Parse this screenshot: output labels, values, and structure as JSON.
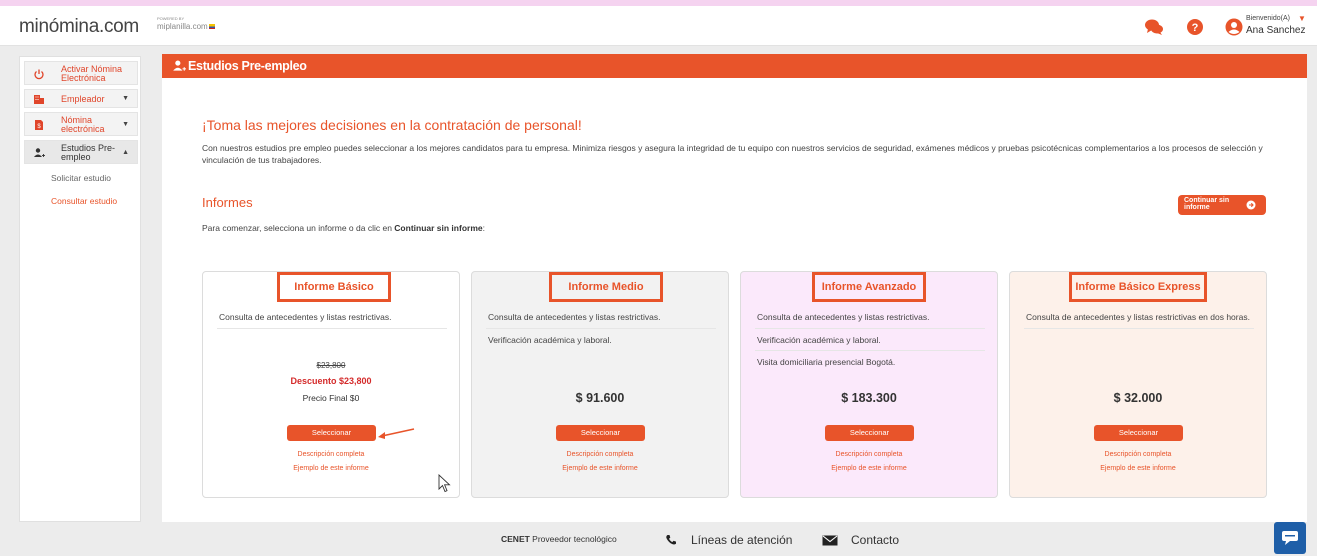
{
  "header": {
    "logo": "minómina.com",
    "powered_by": "POWERED BY",
    "partner": "miplanilla.com",
    "welcome": "Bienvenido(A)",
    "user_name": "Ana Sanchez"
  },
  "sidebar": {
    "items": [
      {
        "label": "Activar Nómina Electrónica"
      },
      {
        "label": "Empleador"
      },
      {
        "label": "Nómina electrónica"
      },
      {
        "label": "Estudios Pre-empleo"
      }
    ],
    "sub_items": [
      {
        "label": "Solicitar estudio"
      },
      {
        "label": "Consultar estudio"
      }
    ]
  },
  "main": {
    "title": "Estudios Pre-empleo",
    "headline": "¡Toma las mejores decisiones en la contratación de personal!",
    "description": "Con nuestros estudios pre empleo puedes seleccionar a los mejores candidatos para tu empresa. Minimiza riesgos y asegura la integridad de tu equipo con nuestros servicios de seguridad, exámenes médicos y pruebas psicotécnicas complementarios a los procesos de selección y vinculación de tus trabajadores.",
    "reports_heading": "Informes",
    "hint_prefix": "Para comenzar, selecciona un informe o da clic en ",
    "hint_bold": "Continuar sin informe",
    "hint_suffix": ":",
    "continue_button": "Continuar sin informe"
  },
  "cards": [
    {
      "title": "Informe Básico",
      "features": [
        "Consulta de antecedentes y listas restrictivas."
      ],
      "old_price": "$23,800",
      "discount": "Descuento $23,800",
      "final_price": "Precio Final $0",
      "select": "Seleccionar",
      "link1": "Descripción completa",
      "link2": "Ejemplo de este informe"
    },
    {
      "title": "Informe Medio",
      "features": [
        "Consulta de antecedentes y listas restrictivas.",
        "Verificación académica y laboral."
      ],
      "price": "$ 91.600",
      "select": "Seleccionar",
      "link1": "Descripción completa",
      "link2": "Ejemplo de este informe"
    },
    {
      "title": "Informe Avanzado",
      "features": [
        "Consulta de antecedentes y listas restrictivas.",
        "Verificación académica y laboral.",
        "Visita domiciliaria presencial Bogotá."
      ],
      "price": "$ 183.300",
      "select": "Seleccionar",
      "link1": "Descripción completa",
      "link2": "Ejemplo de este informe"
    },
    {
      "title": "Informe Básico Express",
      "features": [
        "Consulta de antecedentes y listas restrictivas en dos horas."
      ],
      "price": "$ 32.000",
      "select": "Seleccionar",
      "link1": "Descripción completa",
      "link2": "Ejemplo de este informe"
    }
  ],
  "footer": {
    "provider_bold": "CENET",
    "provider_text": " Proveedor tecnológico",
    "lines": "Líneas de atención",
    "contact": "Contacto"
  },
  "colors": {
    "accent": "#e8542a",
    "card_medio_bg": "#f2f2f2",
    "card_avanzado_bg": "#fbe9fb",
    "card_express_bg": "#fdf1ea",
    "chat_button": "#1f5fa8"
  }
}
